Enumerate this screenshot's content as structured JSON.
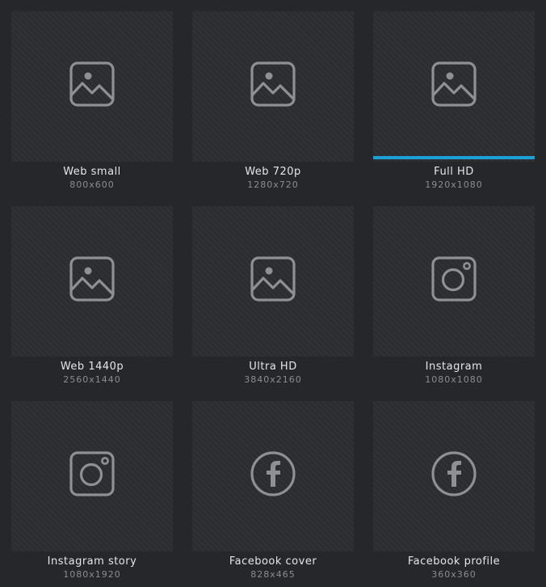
{
  "presets": [
    {
      "name": "Web small",
      "size": "800x600",
      "icon": "image-icon",
      "selected": false
    },
    {
      "name": "Web 720p",
      "size": "1280x720",
      "icon": "image-icon",
      "selected": false
    },
    {
      "name": "Full HD",
      "size": "1920x1080",
      "icon": "image-icon",
      "selected": true
    },
    {
      "name": "Web 1440p",
      "size": "2560x1440",
      "icon": "image-icon",
      "selected": false
    },
    {
      "name": "Ultra HD",
      "size": "3840x2160",
      "icon": "image-icon",
      "selected": false
    },
    {
      "name": "Instagram",
      "size": "1080x1080",
      "icon": "instagram-icon",
      "selected": false
    },
    {
      "name": "Instagram story",
      "size": "1080x1920",
      "icon": "instagram-icon",
      "selected": false
    },
    {
      "name": "Facebook cover",
      "size": "828x465",
      "icon": "facebook-icon",
      "selected": false
    },
    {
      "name": "Facebook profile",
      "size": "360x360",
      "icon": "facebook-icon",
      "selected": false
    }
  ],
  "colors": {
    "background": "#25272b",
    "tile": "#2b2d31",
    "icon": "#8e9094",
    "accent": "#1ca0d6",
    "label": "#e6e6e6",
    "sublabel": "#8b8d91"
  }
}
